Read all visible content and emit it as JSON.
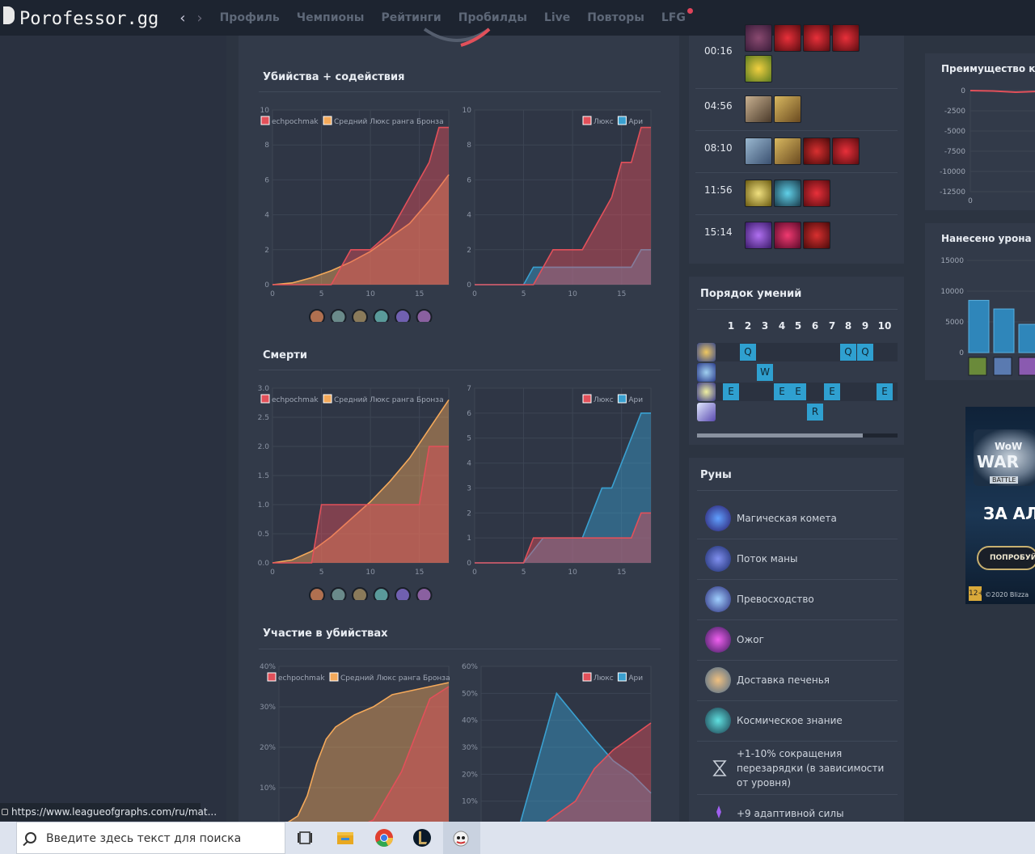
{
  "nav": {
    "logo": "Porofessor.gg",
    "back": "‹",
    "forward": "›",
    "links": [
      "Профиль",
      "Чемпионы",
      "Рейтинги",
      "Пробилды",
      "Live",
      "Повторы",
      "LFG"
    ]
  },
  "sections": {
    "kills_assists": "Убийства + содействия",
    "deaths": "Смерти",
    "kill_participation": "Участие в убийствах"
  },
  "chart_data": [
    {
      "type": "area",
      "title": "Убийства + содействия",
      "series": [
        {
          "name": "echpochmak",
          "color": "#e2505a",
          "x": [
            0,
            2,
            4,
            6,
            7,
            8,
            10,
            12,
            14,
            16,
            17,
            18
          ],
          "y": [
            0,
            0,
            0,
            0,
            1,
            2,
            2,
            3,
            5,
            7,
            9,
            9
          ]
        },
        {
          "name": "Средний Люкс ранга Бронза",
          "color": "#f4a95a",
          "x": [
            0,
            2,
            4,
            6,
            8,
            10,
            12,
            14,
            16,
            18
          ],
          "y": [
            0,
            0.1,
            0.4,
            0.8,
            1.3,
            1.9,
            2.7,
            3.5,
            4.8,
            6.3
          ]
        }
      ],
      "x_ticks": [
        "0",
        "5",
        "10",
        "15"
      ],
      "y_ticks": [
        "0",
        "2",
        "4",
        "6",
        "8",
        "10"
      ],
      "ylim": [
        0,
        10
      ],
      "xlim": [
        0,
        18
      ]
    },
    {
      "type": "area",
      "series": [
        {
          "name": "Люкс",
          "color": "#e2505a",
          "x": [
            0,
            4,
            6,
            7,
            8,
            10,
            11,
            12,
            14,
            15,
            16,
            17,
            18
          ],
          "y": [
            0,
            0,
            0,
            1,
            2,
            2,
            2,
            3,
            5,
            7,
            7,
            9,
            9
          ]
        },
        {
          "name": "Ари",
          "color": "#3aa0d0",
          "x": [
            0,
            4,
            5,
            6,
            8,
            10,
            12,
            14,
            15,
            16,
            17,
            18
          ],
          "y": [
            0,
            0,
            0,
            1,
            1,
            1,
            1,
            1,
            1,
            1,
            2,
            2
          ]
        }
      ],
      "x_ticks": [
        "0",
        "5",
        "10",
        "15"
      ],
      "y_ticks": [
        "0",
        "2",
        "4",
        "6",
        "8",
        "10"
      ],
      "ylim": [
        0,
        10
      ],
      "xlim": [
        0,
        18
      ]
    },
    {
      "type": "area",
      "title": "Смерти",
      "series": [
        {
          "name": "echpochmak",
          "color": "#e2505a",
          "x": [
            0,
            4,
            5,
            10,
            15,
            16,
            18
          ],
          "y": [
            0,
            0,
            1,
            1,
            1,
            2,
            2
          ]
        },
        {
          "name": "Средний Люкс ранга Бронза",
          "color": "#f4a95a",
          "x": [
            0,
            2,
            4,
            6,
            8,
            10,
            12,
            14,
            16,
            18
          ],
          "y": [
            0,
            0.05,
            0.2,
            0.45,
            0.75,
            1.05,
            1.4,
            1.8,
            2.3,
            2.8
          ]
        }
      ],
      "x_ticks": [
        "0",
        "5",
        "10",
        "15"
      ],
      "y_ticks": [
        "0.0",
        "0.5",
        "1.0",
        "1.5",
        "2.0",
        "2.5",
        "3.0"
      ],
      "ylim": [
        0,
        3
      ],
      "xlim": [
        0,
        18
      ]
    },
    {
      "type": "area",
      "series": [
        {
          "name": "Люкс",
          "color": "#e2505a",
          "x": [
            0,
            5,
            6,
            10,
            12,
            16,
            17,
            18
          ],
          "y": [
            0,
            0,
            1,
            1,
            1,
            1,
            2,
            2
          ]
        },
        {
          "name": "Ари",
          "color": "#3aa0d0",
          "x": [
            0,
            5,
            7,
            11,
            12,
            13,
            14,
            15,
            16,
            17,
            18
          ],
          "y": [
            0,
            0,
            1,
            1,
            2,
            3,
            3,
            4,
            5,
            6,
            6
          ]
        }
      ],
      "x_ticks": [
        "0",
        "5",
        "10",
        "15"
      ],
      "y_ticks": [
        "0",
        "1",
        "2",
        "3",
        "4",
        "5",
        "6",
        "7"
      ],
      "ylim": [
        0,
        7
      ],
      "xlim": [
        0,
        18
      ]
    },
    {
      "type": "area",
      "title": "Участие в убийствах",
      "series": [
        {
          "name": "echpochmak",
          "color": "#e2505a",
          "x": [
            0,
            5,
            8,
            10,
            13,
            16,
            18
          ],
          "y": [
            0,
            0,
            0,
            2,
            14,
            32,
            35
          ]
        },
        {
          "name": "Средний Люкс ранга Бронза",
          "color": "#f4a95a",
          "x": [
            0,
            2,
            3,
            4,
            5,
            6,
            8,
            10,
            12,
            14,
            16,
            18
          ],
          "y": [
            0,
            3,
            8,
            16,
            22,
            25,
            28,
            30,
            33,
            34,
            35,
            36
          ]
        }
      ],
      "x_ticks": [],
      "y_ticks": [
        "10%",
        "20%",
        "30%",
        "40%"
      ],
      "ylim": [
        0,
        40
      ],
      "xlim": [
        0,
        18
      ]
    },
    {
      "type": "area",
      "series": [
        {
          "name": "Люкс",
          "color": "#e2505a",
          "x": [
            0,
            4,
            6,
            8,
            10,
            12,
            14,
            16,
            18
          ],
          "y": [
            0,
            0,
            0,
            5,
            10,
            22,
            29,
            34,
            39
          ]
        },
        {
          "name": "Ари",
          "color": "#3aa0d0",
          "x": [
            0,
            4,
            8,
            12,
            14,
            16,
            18
          ],
          "y": [
            0,
            0,
            50,
            33,
            25,
            20,
            13
          ]
        }
      ],
      "x_ticks": [],
      "y_ticks": [
        "10%",
        "20%",
        "30%",
        "40%",
        "50%",
        "60%"
      ],
      "ylim": [
        0,
        60
      ],
      "xlim": [
        0,
        18
      ]
    },
    {
      "type": "line",
      "title": "Преимущество ко",
      "y_ticks": [
        "0",
        "-2500",
        "-5000",
        "-7500",
        "-10000",
        "-12500"
      ],
      "x_ticks": [
        "0"
      ],
      "series": [
        {
          "color": "#e2505a",
          "x": [
            0,
            1,
            2,
            3
          ],
          "y": [
            0,
            -50,
            -200,
            -100
          ]
        }
      ]
    },
    {
      "type": "bar",
      "title": "Нанесено урона",
      "y_ticks": [
        "0",
        "5000",
        "10000",
        "15000"
      ],
      "values": [
        8500,
        7100,
        4600
      ]
    }
  ],
  "items": {
    "rows": [
      {
        "time": "00:16"
      },
      {
        "time": "04:56"
      },
      {
        "time": "08:10"
      },
      {
        "time": "11:56"
      },
      {
        "time": "15:14"
      }
    ]
  },
  "skills": {
    "title": "Порядок умений",
    "levels": [
      "1",
      "2",
      "3",
      "4",
      "5",
      "6",
      "7",
      "8",
      "9",
      "10"
    ],
    "cells": [
      {
        "row": 0,
        "lvl": 2,
        "key": "Q"
      },
      {
        "row": 0,
        "lvl": 8,
        "key": "Q"
      },
      {
        "row": 0,
        "lvl": 9,
        "key": "Q"
      },
      {
        "row": 1,
        "lvl": 3,
        "key": "W"
      },
      {
        "row": 2,
        "lvl": 1,
        "key": "E"
      },
      {
        "row": 2,
        "lvl": 4,
        "key": "E"
      },
      {
        "row": 2,
        "lvl": 5,
        "key": "E"
      },
      {
        "row": 2,
        "lvl": 7,
        "key": "E"
      },
      {
        "row": 2,
        "lvl": 10,
        "key": "E"
      },
      {
        "row": 3,
        "lvl": 6,
        "key": "R"
      }
    ]
  },
  "runes": {
    "title": "Руны",
    "items": [
      "Магическая комета",
      "Поток маны",
      "Превосходство",
      "Ожог",
      "Доставка печенья",
      "Космическое знание",
      "+1-10% сокращения перезарядки (в зависимости от уровня)",
      "+9 адаптивной силы"
    ]
  },
  "ad": {
    "logo": "WoW",
    "brand": "WAR",
    "tag": "BATTLE",
    "headline": "ЗА АЛ",
    "button": "ПОПРОБУЙ",
    "age": "12+",
    "copyright": "©2020 Blizza"
  },
  "status_url": "https://www.leagueofgraphs.com/ru/mat...",
  "taskbar": {
    "search_placeholder": "Введите здесь текст для поиска"
  }
}
